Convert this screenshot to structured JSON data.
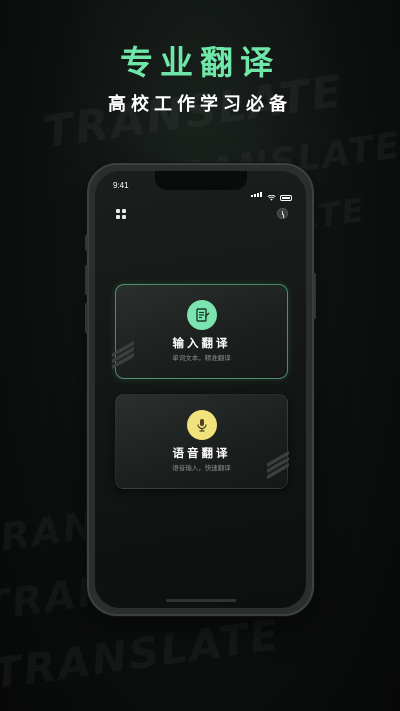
{
  "header": {
    "title": "专业翻译",
    "subtitle": "高校工作学习必备"
  },
  "colors": {
    "accent_green": "#6ee7a9",
    "accent_yellow": "#f1e27c"
  },
  "phone": {
    "status_time": "9:41"
  },
  "cards": [
    {
      "title": "输入翻译",
      "subtitle": "单词文本，精准翻译",
      "icon": "notebook-icon"
    },
    {
      "title": "语音翻译",
      "subtitle": "语音输入，快速翻译",
      "icon": "microphone-icon"
    }
  ]
}
